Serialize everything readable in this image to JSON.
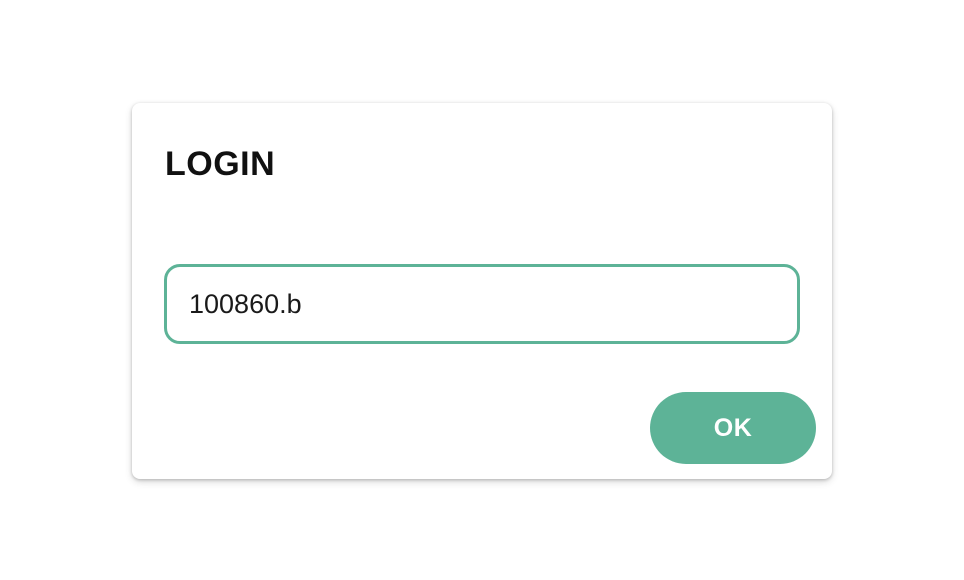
{
  "dialog": {
    "title": "LOGIN",
    "input": {
      "value": "100860.b",
      "placeholder": ""
    },
    "ok_label": "OK"
  },
  "colors": {
    "accent": "#5db397",
    "title_text": "#111111",
    "background": "#ffffff"
  }
}
